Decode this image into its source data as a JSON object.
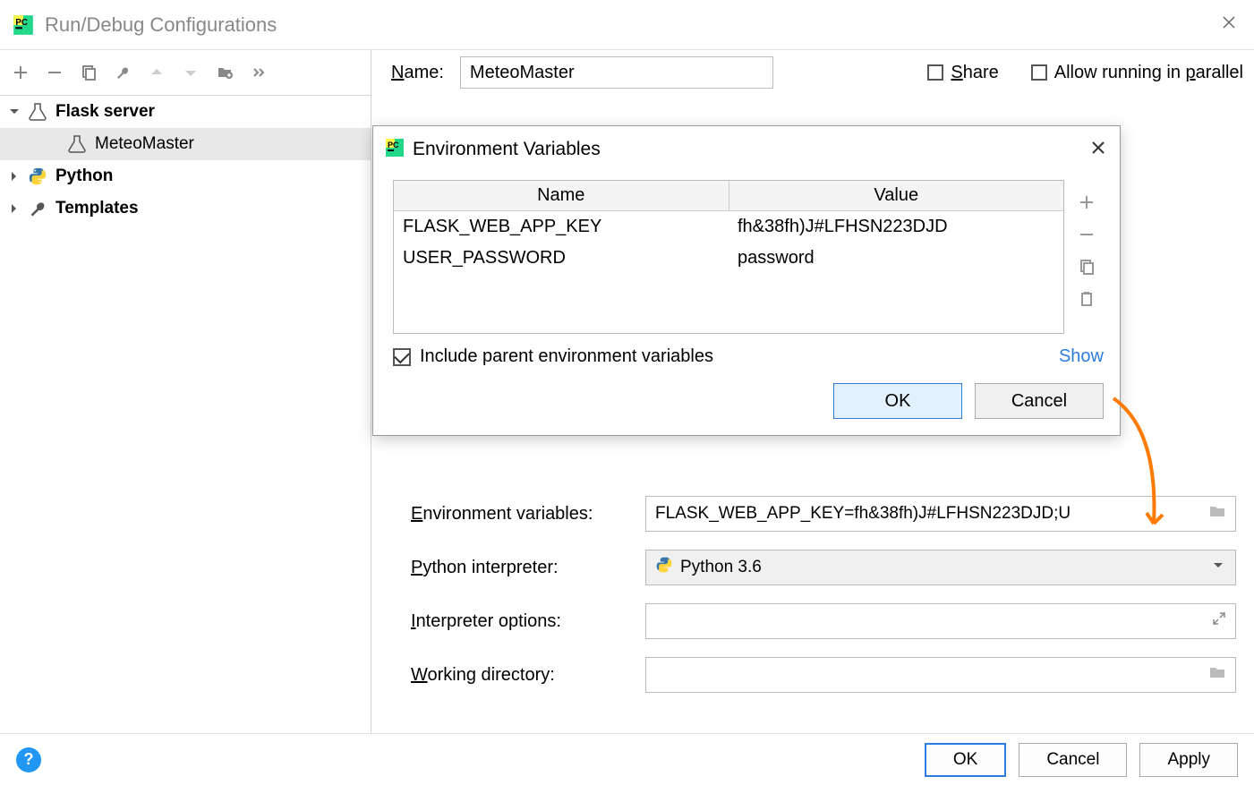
{
  "window": {
    "title": "Run/Debug Configurations"
  },
  "form": {
    "name_label": "Name:",
    "name_value": "MeteoMaster",
    "share_label": "Share",
    "allow_parallel_label": "Allow running in parallel",
    "env_vars_label": "Environment variables:",
    "env_vars_value": "FLASK_WEB_APP_KEY=fh&38fh)J#LFHSN223DJD;U",
    "python_interp_label": "Python interpreter:",
    "python_interp_value": "Python 3.6",
    "interp_options_label": "Interpreter options:",
    "interp_options_value": "",
    "working_dir_label": "Working directory:",
    "working_dir_value": ""
  },
  "tree": {
    "items": [
      {
        "label": "Flask server",
        "expanded": true,
        "icon": "flask"
      },
      {
        "label": "MeteoMaster",
        "child": true,
        "selected": true,
        "icon": "flask"
      },
      {
        "label": "Python",
        "expanded": false,
        "icon": "python"
      },
      {
        "label": "Templates",
        "expanded": false,
        "icon": "wrench"
      }
    ]
  },
  "dialog": {
    "title": "Environment Variables",
    "col_name": "Name",
    "col_value": "Value",
    "rows": [
      {
        "name": "FLASK_WEB_APP_KEY",
        "value": "fh&38fh)J#LFHSN223DJD"
      },
      {
        "name": "USER_PASSWORD",
        "value": "password"
      }
    ],
    "include_parent_label": "Include parent environment variables",
    "show_label": "Show",
    "ok_label": "OK",
    "cancel_label": "Cancel"
  },
  "footer": {
    "ok_label": "OK",
    "cancel_label": "Cancel",
    "apply_label": "Apply"
  }
}
